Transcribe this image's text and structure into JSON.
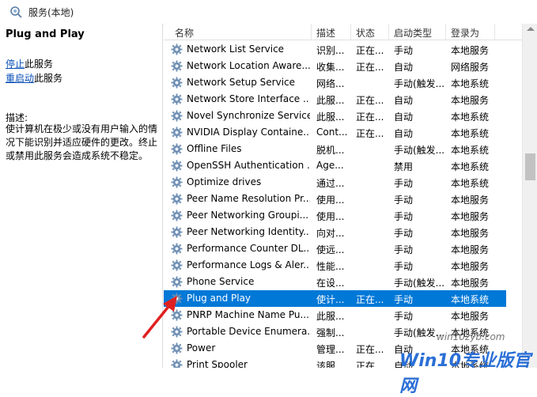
{
  "window": {
    "title": "服务(本地)"
  },
  "left_pane": {
    "service_name": "Plug and Play",
    "stop_link": "停止",
    "stop_suffix": "此服务",
    "restart_link": "重启动",
    "restart_suffix": "此服务",
    "desc_label": "描述:",
    "description": "使计算机在极少或没有用户输入的情况下能识别并适应硬件的更改。终止或禁用此服务会造成系统不稳定。"
  },
  "columns": {
    "name": "名称",
    "desc": "描述",
    "status": "状态",
    "startup": "启动类型",
    "logon": "登录为"
  },
  "rows": [
    {
      "name": "Network List Service",
      "desc": "识别...",
      "status": "正在...",
      "startup": "手动",
      "logon": "本地服务"
    },
    {
      "name": "Network Location Aware...",
      "desc": "收集...",
      "status": "正在...",
      "startup": "自动",
      "logon": "网络服务"
    },
    {
      "name": "Network Setup Service",
      "desc": "网络...",
      "status": "",
      "startup": "手动(触发...",
      "logon": "本地系统"
    },
    {
      "name": "Network Store Interface ...",
      "desc": "此服...",
      "status": "正在...",
      "startup": "自动",
      "logon": "本地服务"
    },
    {
      "name": "Novel Synchronize Service",
      "desc": "此服...",
      "status": "正在...",
      "startup": "自动",
      "logon": "本地系统"
    },
    {
      "name": "NVIDIA Display Containe...",
      "desc": "Cont...",
      "status": "正在...",
      "startup": "自动",
      "logon": "本地系统"
    },
    {
      "name": "Offline Files",
      "desc": "脱机...",
      "status": "",
      "startup": "手动(触发...",
      "logon": "本地系统"
    },
    {
      "name": "OpenSSH Authentication ...",
      "desc": "Age...",
      "status": "",
      "startup": "禁用",
      "logon": "本地系统"
    },
    {
      "name": "Optimize drives",
      "desc": "通过...",
      "status": "",
      "startup": "手动",
      "logon": "本地系统"
    },
    {
      "name": "Peer Name Resolution Pr...",
      "desc": "使用...",
      "status": "",
      "startup": "手动",
      "logon": "本地服务"
    },
    {
      "name": "Peer Networking Groupi...",
      "desc": "使用...",
      "status": "",
      "startup": "手动",
      "logon": "本地服务"
    },
    {
      "name": "Peer Networking Identity...",
      "desc": "向对...",
      "status": "",
      "startup": "手动",
      "logon": "本地服务"
    },
    {
      "name": "Performance Counter DL...",
      "desc": "使远...",
      "status": "",
      "startup": "手动",
      "logon": "本地服务"
    },
    {
      "name": "Performance Logs & Aler...",
      "desc": "性能...",
      "status": "",
      "startup": "手动",
      "logon": "本地服务"
    },
    {
      "name": "Phone Service",
      "desc": "在设...",
      "status": "",
      "startup": "手动(触发...",
      "logon": "本地服务"
    },
    {
      "name": "Plug and Play",
      "desc": "使计...",
      "status": "正在...",
      "startup": "手动",
      "logon": "本地系统"
    },
    {
      "name": "PNRP Machine Name Pu...",
      "desc": "此服...",
      "status": "",
      "startup": "手动",
      "logon": "本地服务"
    },
    {
      "name": "Portable Device Enumera...",
      "desc": "强制...",
      "status": "",
      "startup": "手动(触发...",
      "logon": "本地系统"
    },
    {
      "name": "Power",
      "desc": "管理...",
      "status": "正在...",
      "startup": "自动",
      "logon": "本地系统"
    },
    {
      "name": "Print Spooler",
      "desc": "该服...",
      "status": "正在...",
      "startup": "自动",
      "logon": "本地系统"
    }
  ],
  "selected_row": 15,
  "watermark": {
    "text": "Win10专业版官网",
    "url": "win10zyb.com"
  },
  "colors": {
    "selection": "#0078d7",
    "link": "#0a4fb8",
    "arrow": "#e02020"
  }
}
